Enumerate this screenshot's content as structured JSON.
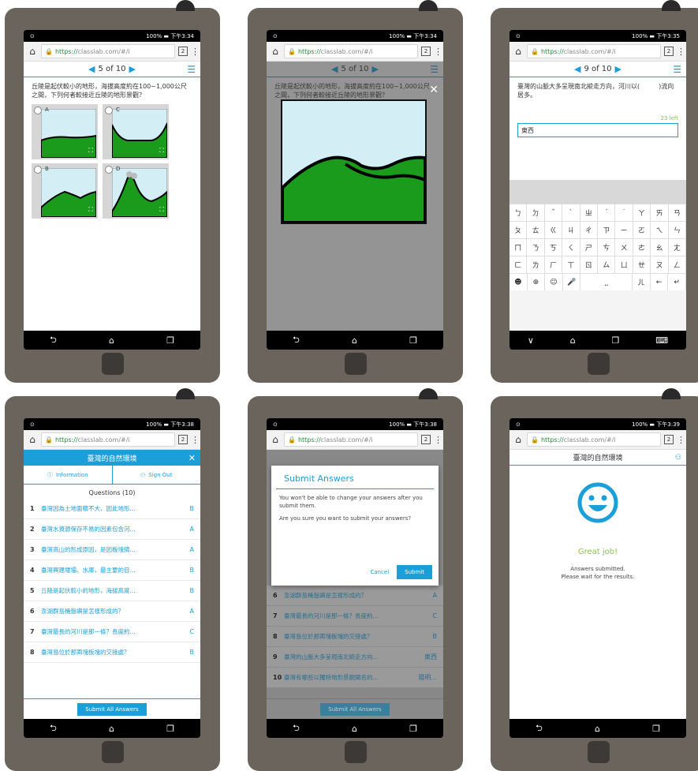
{
  "status": {
    "time1": "下午3:34",
    "time2": "下午3:34",
    "time3": "下午3:35",
    "time4": "下午3:38",
    "time5": "下午3:38",
    "time6": "下午3:39",
    "battery": "100%",
    "sig": "📶"
  },
  "browser": {
    "https": "https://",
    "domain": "classlab.com/#/i",
    "tabs": "2"
  },
  "q5": {
    "pager": "5 of 10",
    "text": "丘陵是起伏較小的地形，海拔高度約在100~1,000公尺之間，下列何者較接近丘陵的地形景觀？",
    "opts": [
      "A",
      "C",
      "B",
      "D"
    ]
  },
  "q9": {
    "pager": "9 of 10",
    "text": "臺灣的山脈大多呈現南北縱走方向，河川以(　　　)流向居多。",
    "left": "23 left",
    "value": "東西",
    "keys": [
      [
        "ㄅ",
        "ㄉ",
        "ˇ",
        "ˋ",
        "ㄓ",
        "ˊ",
        "˙",
        "ㄚ",
        "ㄞ",
        "ㄢ"
      ],
      [
        "ㄆ",
        "ㄊ",
        "ㄍ",
        "ㄐ",
        "ㄔ",
        "ㄗ",
        "ㄧ",
        "ㄛ",
        "ㄟ",
        "ㄣ"
      ],
      [
        "ㄇ",
        "ㄋ",
        "ㄎ",
        "ㄑ",
        "ㄕ",
        "ㄘ",
        "ㄨ",
        "ㄜ",
        "ㄠ",
        "ㄤ"
      ],
      [
        "ㄈ",
        "ㄌ",
        "ㄏ",
        "ㄒ",
        "ㄖ",
        "ㄙ",
        "ㄩ",
        "ㄝ",
        "ㄡ",
        "ㄥ"
      ],
      [
        "☻",
        "⊕",
        "☺",
        "🎤",
        "⎵",
        "",
        "ㄦ",
        "←",
        "↵",
        ""
      ]
    ]
  },
  "panel": {
    "title": "臺灣的自然環境",
    "info": "Information",
    "signout": "Sign Out",
    "questions": "Questions (10)",
    "submit_all": "Submit All Answers",
    "rows": [
      {
        "n": "1",
        "t": "臺灣因為土地面積不大，因此地形...",
        "a": "B"
      },
      {
        "n": "2",
        "t": "臺灣水資源保存不易的因素包含河...",
        "a": "A"
      },
      {
        "n": "3",
        "t": "臺灣高山的形成原因，是因板塊擠...",
        "a": "A"
      },
      {
        "n": "4",
        "t": "臺灣興建堰壩、水庫，最主要的目...",
        "a": "B"
      },
      {
        "n": "5",
        "t": "丘陵是起伏較小的地形，海拔高度...",
        "a": "B"
      },
      {
        "n": "6",
        "t": "澎湖群島桶盤嶼是怎樣形成的？",
        "a": "A"
      },
      {
        "n": "7",
        "t": "臺灣最長的河川是那一條？長度約...",
        "a": "C"
      },
      {
        "n": "8",
        "t": "臺灣島位於那兩塊板塊的交接處？",
        "a": "B"
      }
    ],
    "rows2": [
      {
        "n": "6",
        "t": "澎湖群島桶盤嶼是怎樣形成的？",
        "a": "A"
      },
      {
        "n": "7",
        "t": "臺灣最長的河川是那一條？長度約...",
        "a": "C"
      },
      {
        "n": "8",
        "t": "臺灣島位於那兩塊板塊的交接處？",
        "a": "B"
      },
      {
        "n": "9",
        "t": "臺灣的山脈大多呈現南北縱走方向...",
        "a": "東西"
      },
      {
        "n": "10",
        "t": "臺灣有哪些以獨特地形景觀聞名的...",
        "a": "陽明..."
      }
    ]
  },
  "dialog": {
    "title": "Submit Answers",
    "p1": "You won't be able to change your answers after you submit them.",
    "p2": "Are you sure you want to submit your answers?",
    "cancel": "Cancel",
    "submit": "Submit"
  },
  "done": {
    "title": "臺灣的自然環境",
    "great": "Great job!",
    "msg1": "Answers submitted.",
    "msg2": "Please wait for the results."
  },
  "nav": {
    "back": "⮌",
    "home": "⌂",
    "recent": "❐",
    "down": "∨"
  }
}
